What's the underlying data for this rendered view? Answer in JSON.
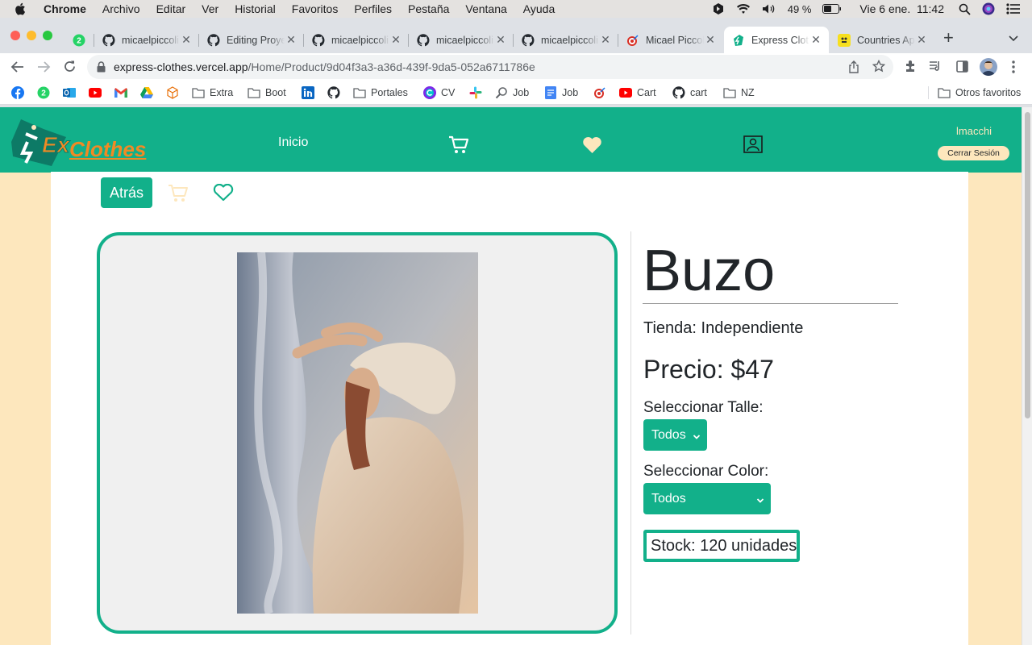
{
  "menubar": {
    "app": "Chrome",
    "items": [
      "Archivo",
      "Editar",
      "Ver",
      "Historial",
      "Favoritos",
      "Perfiles",
      "Pestaña",
      "Ventana",
      "Ayuda"
    ],
    "battery": "49 %",
    "datetime": "Vie 6 ene.  11:42"
  },
  "tabs": [
    {
      "title": "",
      "icon": "whatsapp-icon",
      "badge": "2"
    },
    {
      "title": "micaelpiccoli",
      "icon": "github-icon"
    },
    {
      "title": "Editing Proyecto",
      "icon": "github-icon"
    },
    {
      "title": "micaelpiccoli",
      "icon": "github-icon"
    },
    {
      "title": "micaelpiccoli",
      "icon": "github-icon"
    },
    {
      "title": "micaelpiccoli",
      "icon": "github-icon"
    },
    {
      "title": "Micael Piccoli",
      "icon": "target-icon"
    },
    {
      "title": "Express Clothes",
      "icon": "express-clothes-icon",
      "active": true
    },
    {
      "title": "Countries App",
      "icon": "countries-icon"
    }
  ],
  "address": {
    "host": "express-clothes.vercel.app",
    "path": "/Home/Product/9d04f3a3-a36d-439f-9da5-052a6711786e"
  },
  "bookmarks": [
    {
      "label": "",
      "icon": "facebook-icon"
    },
    {
      "label": "",
      "icon": "whatsapp-icon"
    },
    {
      "label": "",
      "icon": "outlook-icon"
    },
    {
      "label": "",
      "icon": "youtube-icon"
    },
    {
      "label": "",
      "icon": "gmail-icon"
    },
    {
      "label": "",
      "icon": "drive-icon"
    },
    {
      "label": "",
      "icon": "cube-icon"
    },
    {
      "label": "Extra",
      "icon": "folder-icon"
    },
    {
      "label": "Boot",
      "icon": "folder-icon"
    },
    {
      "label": "",
      "icon": "linkedin-icon"
    },
    {
      "label": "",
      "icon": "github-icon"
    },
    {
      "label": "Portales",
      "icon": "folder-icon"
    },
    {
      "label": "CV",
      "icon": "canva-icon"
    },
    {
      "label": "",
      "icon": "slack-icon"
    },
    {
      "label": "Job",
      "icon": "search-icon"
    },
    {
      "label": "Job",
      "icon": "docs-icon"
    },
    {
      "label": "",
      "icon": "target-icon"
    },
    {
      "label": "Cart",
      "icon": "youtube-icon"
    },
    {
      "label": "cart",
      "icon": "github-icon"
    },
    {
      "label": "NZ",
      "icon": "folder-icon"
    },
    {
      "label": "Otros favoritos",
      "icon": "folder-icon"
    }
  ],
  "site": {
    "logo_text": "Clothes",
    "logo_prefix": "Ex",
    "nav_home": "Inicio",
    "username": "lmacchi",
    "logout": "Cerrar Sesión",
    "accent": "#12b08a",
    "background": "#fde7bd"
  },
  "product": {
    "back": "Atrás",
    "title": "Buzo",
    "store": "Tienda: Independiente",
    "price": "Precio: $47",
    "size_label": "Seleccionar Talle:",
    "size_value": "Todos",
    "color_label": "Seleccionar Color:",
    "color_value": "Todos",
    "stock": "Stock: 120 unidades"
  }
}
